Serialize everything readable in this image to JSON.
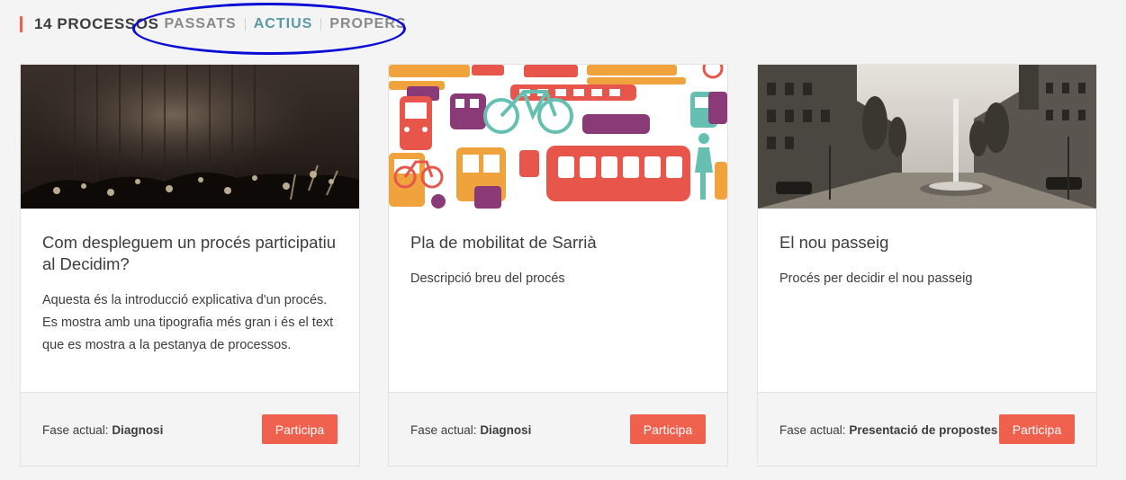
{
  "header": {
    "count_label": "14 PROCESSOS",
    "filters": [
      {
        "label": "PASSATS",
        "active": false
      },
      {
        "label": "ACTIUS",
        "active": true
      },
      {
        "label": "PROPERS",
        "active": false
      }
    ]
  },
  "cards": [
    {
      "title": "Com despleguem un procés participatiu al Decidim?",
      "description": "Aquesta és la introducció explicativa d'un procés. Es mostra amb una tipografia més gran i és el text que es mostra a la pestanya de processos.",
      "phase_label": "Fase actual:",
      "phase_value": "Diagnosi",
      "button": "Participa"
    },
    {
      "title": "Pla de mobilitat de Sarrià",
      "description": "Descripció breu del procés",
      "phase_label": "Fase actual:",
      "phase_value": "Diagnosi",
      "button": "Participa"
    },
    {
      "title": "El nou passeig",
      "description": "Procés per decidir el nou passeig",
      "phase_label": "Fase actual:",
      "phase_value": "Presentació de propostes",
      "button": "Participa"
    }
  ],
  "colors": {
    "accent": "#ef604d",
    "active_filter": "#599aa6",
    "annotation": "#0b0bd6"
  }
}
